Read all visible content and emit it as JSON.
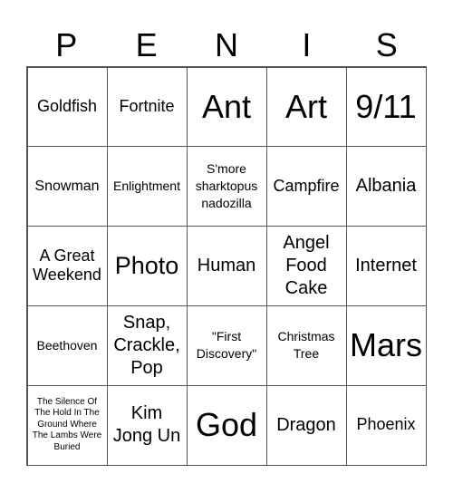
{
  "header": [
    "P",
    "E",
    "N",
    "I",
    "S"
  ],
  "cells": [
    [
      "Goldfish",
      "Fortnite",
      "Ant",
      "Art",
      "9/11"
    ],
    [
      "Snowman",
      "Enlightment",
      "S'more sharktopus nadozilla",
      "Campfire",
      "Albania"
    ],
    [
      "A Great Weekend",
      "Photo",
      "Human",
      "Angel Food Cake",
      "Internet"
    ],
    [
      "Beethoven",
      "Snap, Crackle, Pop",
      "\"First Discovery\"",
      "Christmas Tree",
      "Mars"
    ],
    [
      "The Silence Of The Hold In The Ground Where The Lambs Were Buried",
      "Kim Jong Un",
      "God",
      "Dragon",
      "Phoenix"
    ]
  ]
}
